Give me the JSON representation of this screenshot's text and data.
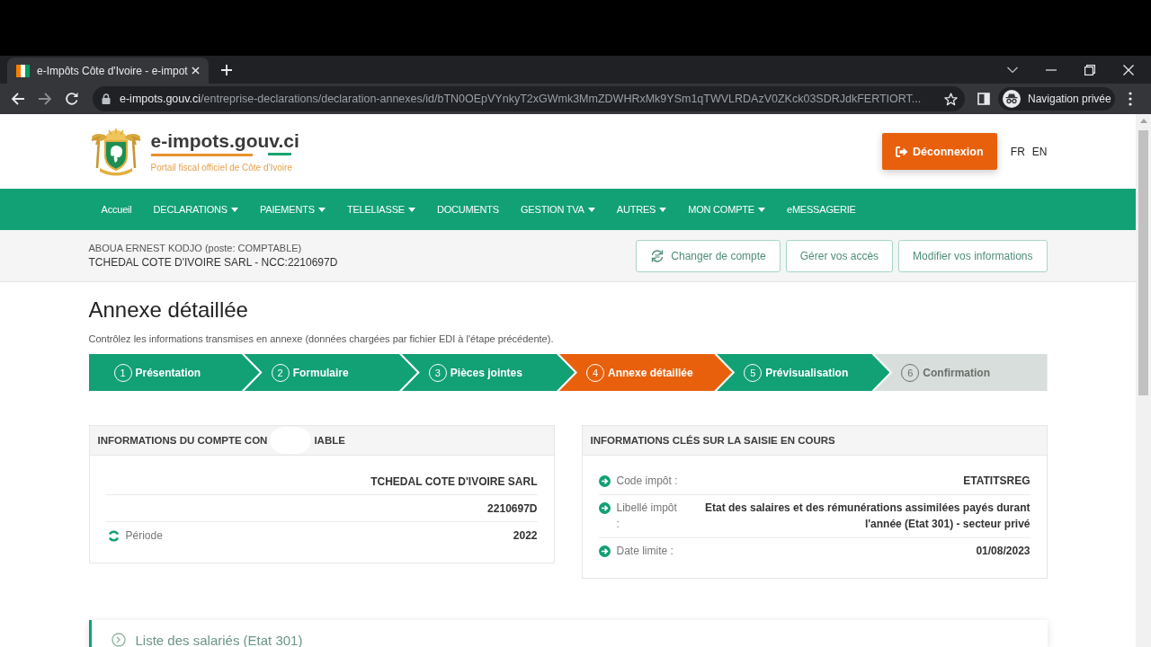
{
  "browser": {
    "tab_title": "e-Impôts Côte d'Ivoire - e-impot",
    "nav_buttons": [
      {
        "kind": "back",
        "disabled": false
      },
      {
        "kind": "forward",
        "disabled": true
      },
      {
        "kind": "reload",
        "disabled": false
      }
    ],
    "url": {
      "host": "e-impots.gouv.ci",
      "path": "/entreprise-declarations/declaration-annexes/id/bTN0OEpVYnkyT2xGWmk3MmZDWHRxMk9YSm1qTWVLRDAzV0ZKck03SDRJdkFERTIORT..."
    },
    "profile_label": "Navigation privée"
  },
  "header": {
    "site_name": "e-impots.gouv.ci",
    "tagline": "Portail fiscal officiel de Côte d'Ivoire",
    "logout_button": "Déconnexion",
    "languages": [
      "FR",
      "EN"
    ]
  },
  "nav": [
    {
      "label": "Accueil",
      "dropdown": false
    },
    {
      "label": "DECLARATIONS",
      "dropdown": true
    },
    {
      "label": "PAIEMENTS",
      "dropdown": true
    },
    {
      "label": "TELELIASSE",
      "dropdown": true
    },
    {
      "label": "DOCUMENTS",
      "dropdown": false
    },
    {
      "label": "GESTION TVA",
      "dropdown": true
    },
    {
      "label": "AUTRES",
      "dropdown": true
    },
    {
      "label": "MON COMPTE",
      "dropdown": true
    },
    {
      "label": "eMESSAGERIE",
      "dropdown": false
    }
  ],
  "user_bar": {
    "user": "ABOUA ERNEST KODJO (poste: COMPTABLE)",
    "company": "TCHEDAL COTE D'IVOIRE SARL - NCC:2210697D",
    "buttons": [
      {
        "label": "Changer de compte",
        "icon": true
      },
      {
        "label": "Gérer vos accès",
        "icon": false
      },
      {
        "label": "Modifier vos informations",
        "icon": false
      }
    ]
  },
  "page": {
    "title": "Annexe détaillée",
    "subtitle": "Contrôlez les informations transmises en annexe (données chargées par fichier EDI à l'étape précédente)."
  },
  "steps": [
    {
      "number": "1",
      "label": "Présentation",
      "selected": false,
      "disabled": false
    },
    {
      "number": "2",
      "label": "Formulaire",
      "selected": false,
      "disabled": false
    },
    {
      "number": "3",
      "label": "Pièces jointes",
      "selected": false,
      "disabled": false
    },
    {
      "number": "4",
      "label": "Annexe détaillée",
      "selected": true,
      "disabled": false
    },
    {
      "number": "5",
      "label": "Prévisualisation",
      "selected": false,
      "disabled": false
    },
    {
      "number": "6",
      "label": "Confirmation",
      "selected": false,
      "disabled": true
    }
  ],
  "account_card": {
    "title_parts": [
      "INFORMATIONS DU COMPTE CON",
      "IABLE"
    ],
    "rows": [
      {
        "value": "TCHEDAL COTE D'IVOIRE SARL"
      },
      {
        "value": "2210697D"
      },
      {
        "label": "Période",
        "value": "2022"
      }
    ]
  },
  "info_card": {
    "title": "INFORMATIONS CLÉS SUR LA SAISIE EN COURS",
    "rows": [
      {
        "label": "Code impôt :",
        "value": "ETATITSREG"
      },
      {
        "label": "Libellé impôt :",
        "value": "Etat des salaires et des rémunérations assimilées payés durant l'année (Etat 301) - secteur privé"
      },
      {
        "label": "Date limite :",
        "value": "01/08/2023"
      }
    ]
  },
  "section": {
    "title": "Liste des salariés (Etat 301)"
  }
}
